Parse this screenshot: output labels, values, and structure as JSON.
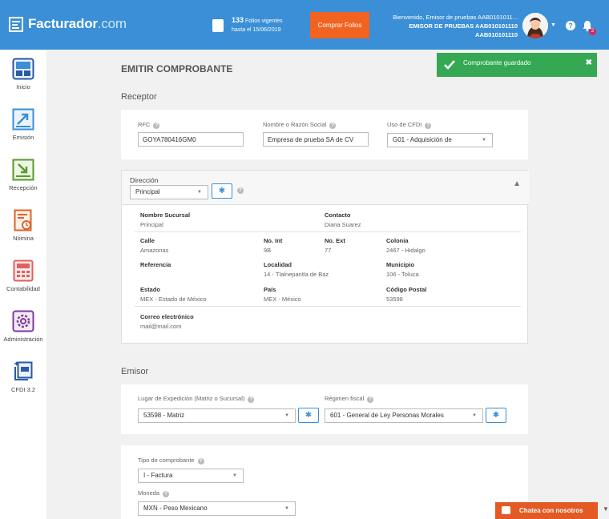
{
  "header": {
    "logo_main": "Facturador",
    "logo_suffix": ".com",
    "folios_count": "133",
    "folios_label": "Folios vigentes",
    "folios_until": "hasta el 15/06/2019",
    "buy_button": "Comprar Folios",
    "welcome": "Bienvenido, Emisor de pruebas AAB0101011...",
    "company": "EMISOR DE PRUEBAS AAB010101110",
    "rfc": "AAB010101110",
    "help": "?",
    "notifications": "2"
  },
  "sidebar": {
    "items": [
      {
        "label": "Inicio",
        "icon": "home-icon",
        "color": "#3a6fb0"
      },
      {
        "label": "Emisión",
        "icon": "emission-icon",
        "color": "#3a8fd6"
      },
      {
        "label": "Recepción",
        "icon": "reception-icon",
        "color": "#5a9a2e"
      },
      {
        "label": "Nómina",
        "icon": "payroll-icon",
        "color": "#e0622a"
      },
      {
        "label": "Contabilidad",
        "icon": "accounting-icon",
        "color": "#e06060"
      },
      {
        "label": "Administración",
        "icon": "admin-icon",
        "color": "#7d3c98"
      },
      {
        "label": "CFDI 3.2",
        "icon": "cfdi-icon",
        "color": "#2c5aa0"
      }
    ]
  },
  "page": {
    "title": "EMITIR COMPROBANTE"
  },
  "receptor": {
    "section": "Receptor",
    "rfc_label": "RFC",
    "rfc_value": "GOYA780416GM0",
    "name_label": "Nombre o Razón Social",
    "name_value": "Empresa de prueba SA de CV",
    "cfdi_label": "Uso de CFDI",
    "cfdi_value": "G01 - Adquisición de"
  },
  "direccion": {
    "label": "Dirección",
    "select_value": "Principal",
    "fields": {
      "sucursal_label": "Nombre Sucursal",
      "sucursal_value": "Principal",
      "contacto_label": "Contacto",
      "contacto_value": "Diana Suarez",
      "calle_label": "Calle",
      "calle_value": "Amazonas",
      "noint_label": "No. Int",
      "noint_value": "9B",
      "noext_label": "No. Ext",
      "noext_value": "77",
      "colonia_label": "Colonia",
      "colonia_value": "2467 - Hidalgo",
      "referencia_label": "Referencia",
      "localidad_label": "Localidad",
      "localidad_value": "14 - Tlalnepantla de Baz",
      "municipio_label": "Municipio",
      "municipio_value": "106 - Toluca",
      "estado_label": "Estado",
      "estado_value": "MEX - Estado de México",
      "pais_label": "País",
      "pais_value": "MEX - México",
      "cp_label": "Código Postal",
      "cp_value": "53598",
      "correo_label": "Correo electrónico",
      "correo_value": "mail@mail.com"
    }
  },
  "emisor": {
    "section": "Emisor",
    "lugar_label": "Lugar de Expedición (Matriz o Sucursal)",
    "lugar_value": "53598 - Matriz",
    "regimen_label": "Régimen fiscal",
    "regimen_value": "601 - General de Ley Personas Morales"
  },
  "comprobante": {
    "tipo_label": "Tipo de comprobante",
    "tipo_value": "I - Factura",
    "moneda_label": "Moneda",
    "moneda_value": "MXN - Peso Mexicano"
  },
  "toast": {
    "message": "Comprobante guardado",
    "close": "✖"
  },
  "chat": {
    "label": "Chatea con nosotros"
  },
  "glyphs": {
    "caret": "▼",
    "caret_up": "▲",
    "gear": "✱",
    "help": "?"
  }
}
